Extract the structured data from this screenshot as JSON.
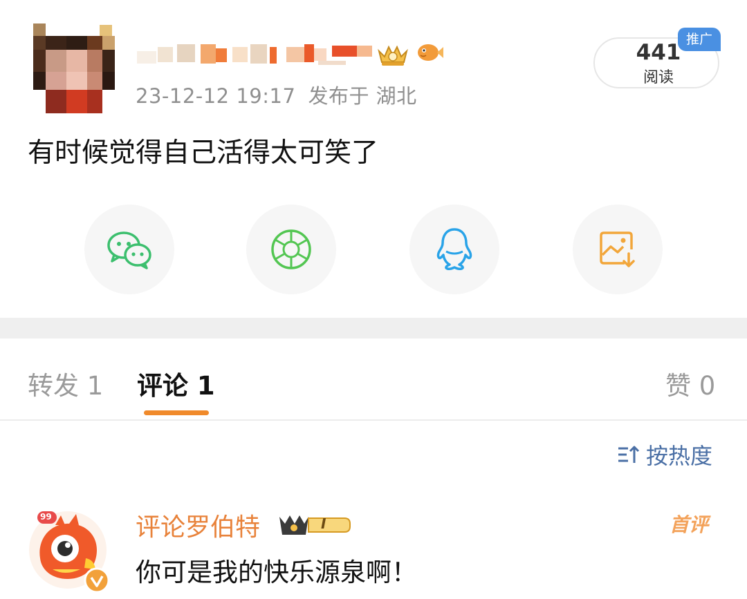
{
  "post": {
    "timestamp": "23-12-12 19:17",
    "location": "发布于 湖北",
    "text": "有时候觉得自己活得太可笑了",
    "read_count": "441",
    "read_label": "阅读",
    "promo_tag": "推广"
  },
  "share": [
    {
      "icon": "wechat-icon",
      "color": "#3cbf6e"
    },
    {
      "icon": "moments-icon",
      "color": "#53c652"
    },
    {
      "icon": "qq-icon",
      "color": "#29a3e8"
    },
    {
      "icon": "save-image-icon",
      "color": "#f2a63a"
    }
  ],
  "tabs": {
    "repost": "转发 1",
    "comments": "评论 1",
    "likes": "赞 0"
  },
  "sort_label": "按热度",
  "comment": {
    "author": "评论罗伯特",
    "level": "I",
    "badge": "首评",
    "avatar_number": "99",
    "text": "你可是我的快乐源泉啊！"
  },
  "colors": {
    "accent": "#f08a2b",
    "link": "#4a6fa5",
    "promo": "#4a90e2"
  }
}
